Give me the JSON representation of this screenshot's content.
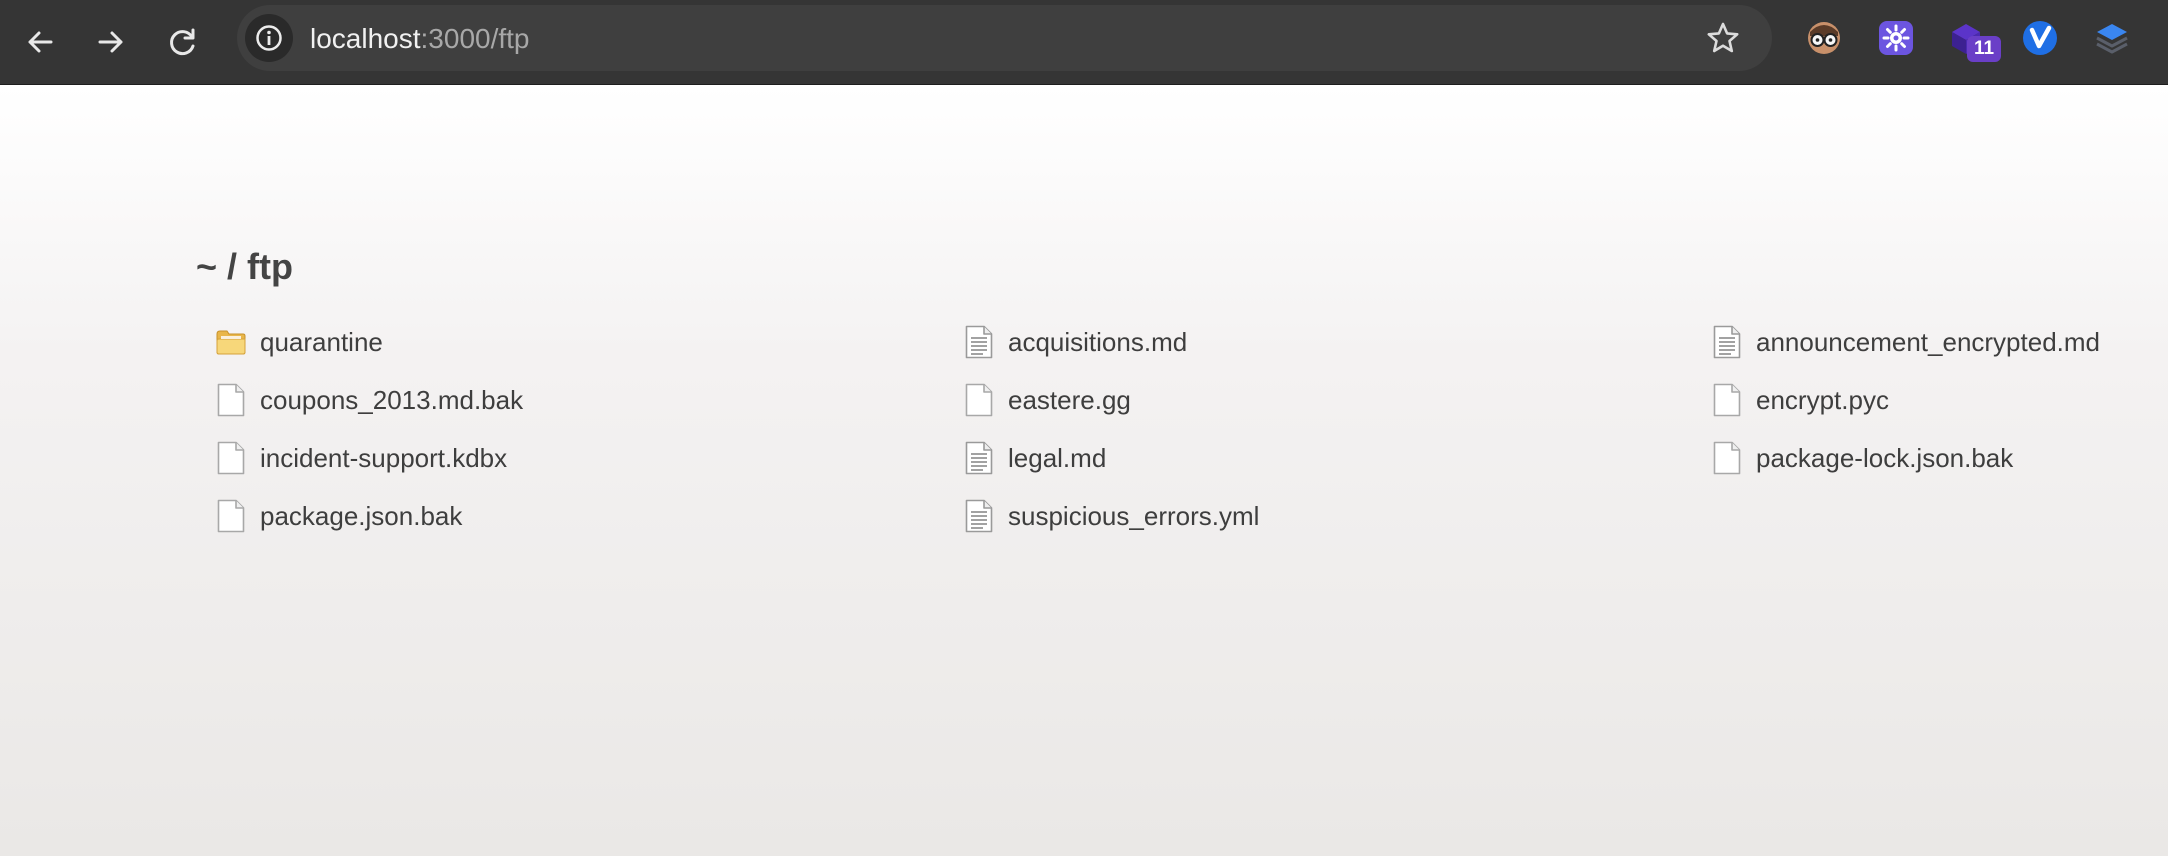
{
  "browser": {
    "url_host": "localhost",
    "url_rest": ":3000/ftp",
    "extensions": [
      {
        "icon": "reading-glasses-avatar-icon"
      },
      {
        "icon": "purple-gear-extension-icon"
      },
      {
        "icon": "purple-cube-extension-icon",
        "badge": "11"
      },
      {
        "icon": "v-check-extension-icon"
      },
      {
        "icon": "layers-extension-icon"
      }
    ],
    "colors": {
      "toolbar": "#353535",
      "omnibox": "#3f3f3f"
    }
  },
  "page": {
    "breadcrumb": "~ / ftp",
    "columns": [
      [
        {
          "name": "quarantine",
          "type": "folder"
        },
        {
          "name": "coupons_2013.md.bak",
          "type": "file"
        },
        {
          "name": "incident-support.kdbx",
          "type": "file"
        },
        {
          "name": "package.json.bak",
          "type": "file"
        }
      ],
      [
        {
          "name": "acquisitions.md",
          "type": "text"
        },
        {
          "name": "eastere.gg",
          "type": "file"
        },
        {
          "name": "legal.md",
          "type": "text"
        },
        {
          "name": "suspicious_errors.yml",
          "type": "text"
        }
      ],
      [
        {
          "name": "announcement_encrypted.md",
          "type": "text"
        },
        {
          "name": "encrypt.pyc",
          "type": "file"
        },
        {
          "name": "package-lock.json.bak",
          "type": "file"
        }
      ]
    ]
  }
}
